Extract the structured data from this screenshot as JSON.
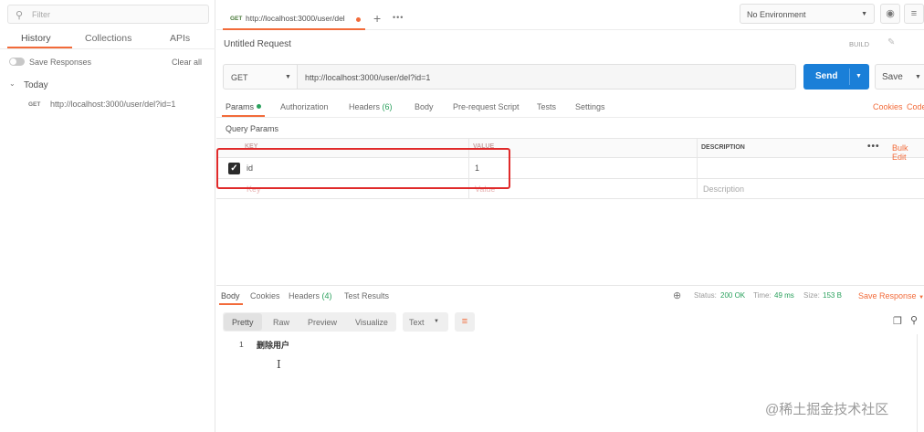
{
  "sidebar": {
    "filter_placeholder": "Filter",
    "tabs": [
      {
        "label": "History"
      },
      {
        "label": "Collections"
      },
      {
        "label": "APIs"
      }
    ],
    "save_responses_label": "Save Responses",
    "clear_all_label": "Clear all",
    "group_label": "Today",
    "history_items": [
      {
        "method": "GET",
        "url": "http://localhost:3000/user/del?id=1"
      }
    ]
  },
  "tabbar": {
    "active_tab": {
      "method": "GET",
      "url": "http://localhost:3000/user/del"
    },
    "new_tab_glyph": "+",
    "more_glyph": "•••"
  },
  "environment": {
    "selected": "No Environment"
  },
  "request": {
    "title": "Untitled Request",
    "build_label": "BUILD",
    "method": "GET",
    "url": "http://localhost:3000/user/del?id=1",
    "send_label": "Send",
    "save_label": "Save"
  },
  "request_tabs": {
    "params": "Params",
    "authorization": "Authorization",
    "headers": "Headers",
    "headers_count": "(6)",
    "body": "Body",
    "pre_request": "Pre-request Script",
    "tests": "Tests",
    "settings": "Settings",
    "cookies": "Cookies",
    "code": "Code"
  },
  "query_params": {
    "title": "Query Params",
    "columns": {
      "key": "KEY",
      "value": "VALUE",
      "description": "DESCRIPTION"
    },
    "bulk_edit": "Bulk Edit",
    "rows": [
      {
        "checked": true,
        "key": "id",
        "value": "1",
        "description": ""
      }
    ],
    "placeholder_row": {
      "key": "Key",
      "value": "Value",
      "description": "Description"
    }
  },
  "response": {
    "tabs": {
      "body": "Body",
      "cookies": "Cookies",
      "headers": "Headers",
      "headers_count": "(4)",
      "test_results": "Test Results"
    },
    "status_label": "Status:",
    "status_value": "200 OK",
    "time_label": "Time:",
    "time_value": "49 ms",
    "size_label": "Size:",
    "size_value": "153 B",
    "save_response": "Save Response",
    "formats": {
      "pretty": "Pretty",
      "raw": "Raw",
      "preview": "Preview",
      "visualize": "Visualize"
    },
    "content_type": "Text",
    "lines": [
      {
        "number": "1",
        "text": "删除用户"
      }
    ]
  },
  "watermark": "@稀土掘金技术社区",
  "colors": {
    "accent": "#f26b3a",
    "send": "#1a7fd8",
    "success": "#2aa15d",
    "highlight": "#e02a2a"
  }
}
